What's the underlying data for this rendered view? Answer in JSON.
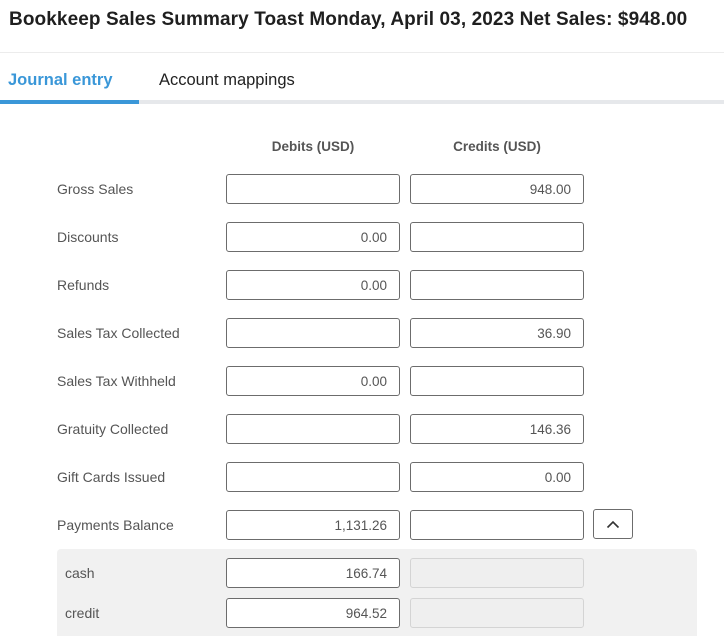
{
  "header": {
    "title": "Bookkeep Sales Summary Toast Monday, April 03, 2023 Net Sales: $948.00"
  },
  "tabs": [
    {
      "label": "Journal entry",
      "active": true
    },
    {
      "label": "Account mappings",
      "active": false
    }
  ],
  "colors": {
    "accent": "#3a97d8"
  },
  "columns": {
    "debits": "Debits (USD)",
    "credits": "Credits (USD)"
  },
  "rows": [
    {
      "label": "Gross Sales",
      "debit": "",
      "credit": "948.00"
    },
    {
      "label": "Discounts",
      "debit": "0.00",
      "credit": ""
    },
    {
      "label": "Refunds",
      "debit": "0.00",
      "credit": ""
    },
    {
      "label": "Sales Tax Collected",
      "debit": "",
      "credit": "36.90"
    },
    {
      "label": "Sales Tax Withheld",
      "debit": "0.00",
      "credit": ""
    },
    {
      "label": "Gratuity Collected",
      "debit": "",
      "credit": "146.36"
    },
    {
      "label": "Gift Cards Issued",
      "debit": "",
      "credit": "0.00"
    },
    {
      "label": "Payments Balance",
      "debit": "1,131.26",
      "credit": ""
    }
  ],
  "payments_breakdown": {
    "toggle_icon": "chevron-up-icon",
    "items": [
      {
        "label": "cash",
        "debit": "166.74",
        "credit": ""
      },
      {
        "label": "credit",
        "debit": "964.52",
        "credit": ""
      }
    ]
  }
}
